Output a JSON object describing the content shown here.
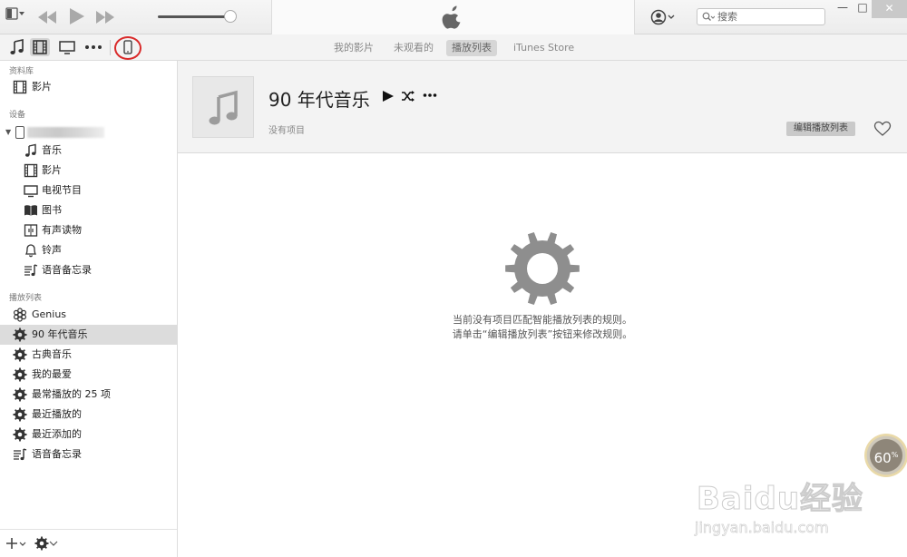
{
  "topbar": {
    "menu_icon": "menu-icon",
    "prev_icon": "previous-track-icon",
    "play_icon": "play-icon",
    "next_icon": "next-track-icon",
    "volume_level": 0.9,
    "logo_icon": "apple-logo",
    "account_icon": "account-icon",
    "search_placeholder": "搜索",
    "window_controls": {
      "minimize": "—",
      "maximize": "□",
      "close": "✕"
    }
  },
  "nav": {
    "media_types": [
      {
        "icon": "music-note-icon"
      },
      {
        "icon": "film-icon",
        "selected": true
      },
      {
        "icon": "tv-icon"
      },
      {
        "icon": "more-icon"
      },
      {
        "icon": "iphone-device-icon"
      }
    ],
    "tabs": [
      {
        "label": "我的影片"
      },
      {
        "label": "未观看的"
      },
      {
        "label": "播放列表",
        "selected": true
      },
      {
        "label": "iTunes Store"
      }
    ]
  },
  "sidebar": {
    "library_header": "资料库",
    "library_items": [
      {
        "label": "影片",
        "icon": "film-icon"
      }
    ],
    "devices_header": "设备",
    "device_items": [
      {
        "label": "音乐",
        "icon": "music-note-icon"
      },
      {
        "label": "影片",
        "icon": "film-icon"
      },
      {
        "label": "电视节目",
        "icon": "tv-icon"
      },
      {
        "label": "图书",
        "icon": "book-icon"
      },
      {
        "label": "有声读物",
        "icon": "audiobook-icon"
      },
      {
        "label": "铃声",
        "icon": "bell-icon"
      },
      {
        "label": "语音备忘录",
        "icon": "voice-memo-icon"
      }
    ],
    "playlists_header": "播放列表",
    "playlist_items": [
      {
        "label": "Genius",
        "icon": "genius-icon"
      },
      {
        "label": "90 年代音乐",
        "icon": "gear-icon",
        "selected": true
      },
      {
        "label": "古典音乐",
        "icon": "gear-icon"
      },
      {
        "label": "我的最爱",
        "icon": "gear-icon"
      },
      {
        "label": "最常播放的 25 项",
        "icon": "gear-icon"
      },
      {
        "label": "最近播放的",
        "icon": "gear-icon"
      },
      {
        "label": "最近添加的",
        "icon": "gear-icon"
      },
      {
        "label": "语音备忘录",
        "icon": "voice-memo-icon"
      }
    ]
  },
  "playlist": {
    "title": "90 年代音乐",
    "subtitle": "没有项目",
    "edit_label": "编辑播放列表",
    "empty_line1": "当前没有项目匹配智能播放列表的规则。",
    "empty_line2": "请单击“编辑播放列表”按钮来修改规则。"
  },
  "overlay": {
    "percent_value": "60",
    "percent_unit": "%",
    "watermark_brand": "Baidu经验",
    "watermark_url": "jingyan.baidu.com"
  },
  "colors": {
    "highlight_ring": "#d92a2a",
    "selected_row": "#dcdcdc"
  }
}
